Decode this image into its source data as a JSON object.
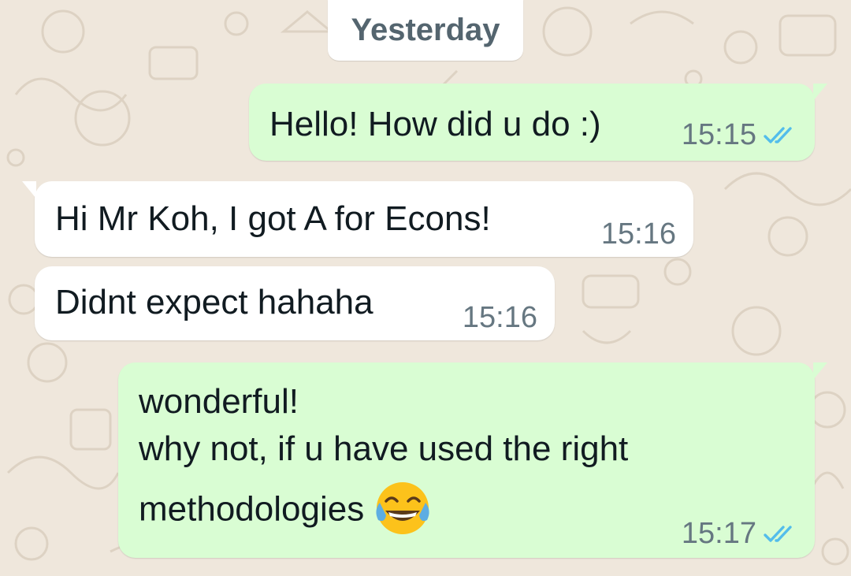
{
  "date_divider": "Yesterday",
  "messages": [
    {
      "direction": "outgoing",
      "text": "Hello! How did u do :)",
      "time": "15:15",
      "status": "read"
    },
    {
      "direction": "incoming",
      "text": "Hi Mr Koh, I got A for Econs!",
      "time": "15:16"
    },
    {
      "direction": "incoming",
      "text": "Didnt expect hahaha",
      "time": "15:16"
    },
    {
      "direction": "outgoing",
      "lines": [
        "wonderful!",
        "why not, if u have used the right",
        "methodologies"
      ],
      "emoji": "tears-of-joy-emoji",
      "time": "15:17",
      "status": "read"
    }
  ],
  "colors": {
    "outgoing_bubble": "#d9fdd3",
    "incoming_bubble": "#ffffff",
    "wallpaper": "#efe7dc",
    "read_ticks": "#53bdeb",
    "meta_text": "#667781"
  }
}
